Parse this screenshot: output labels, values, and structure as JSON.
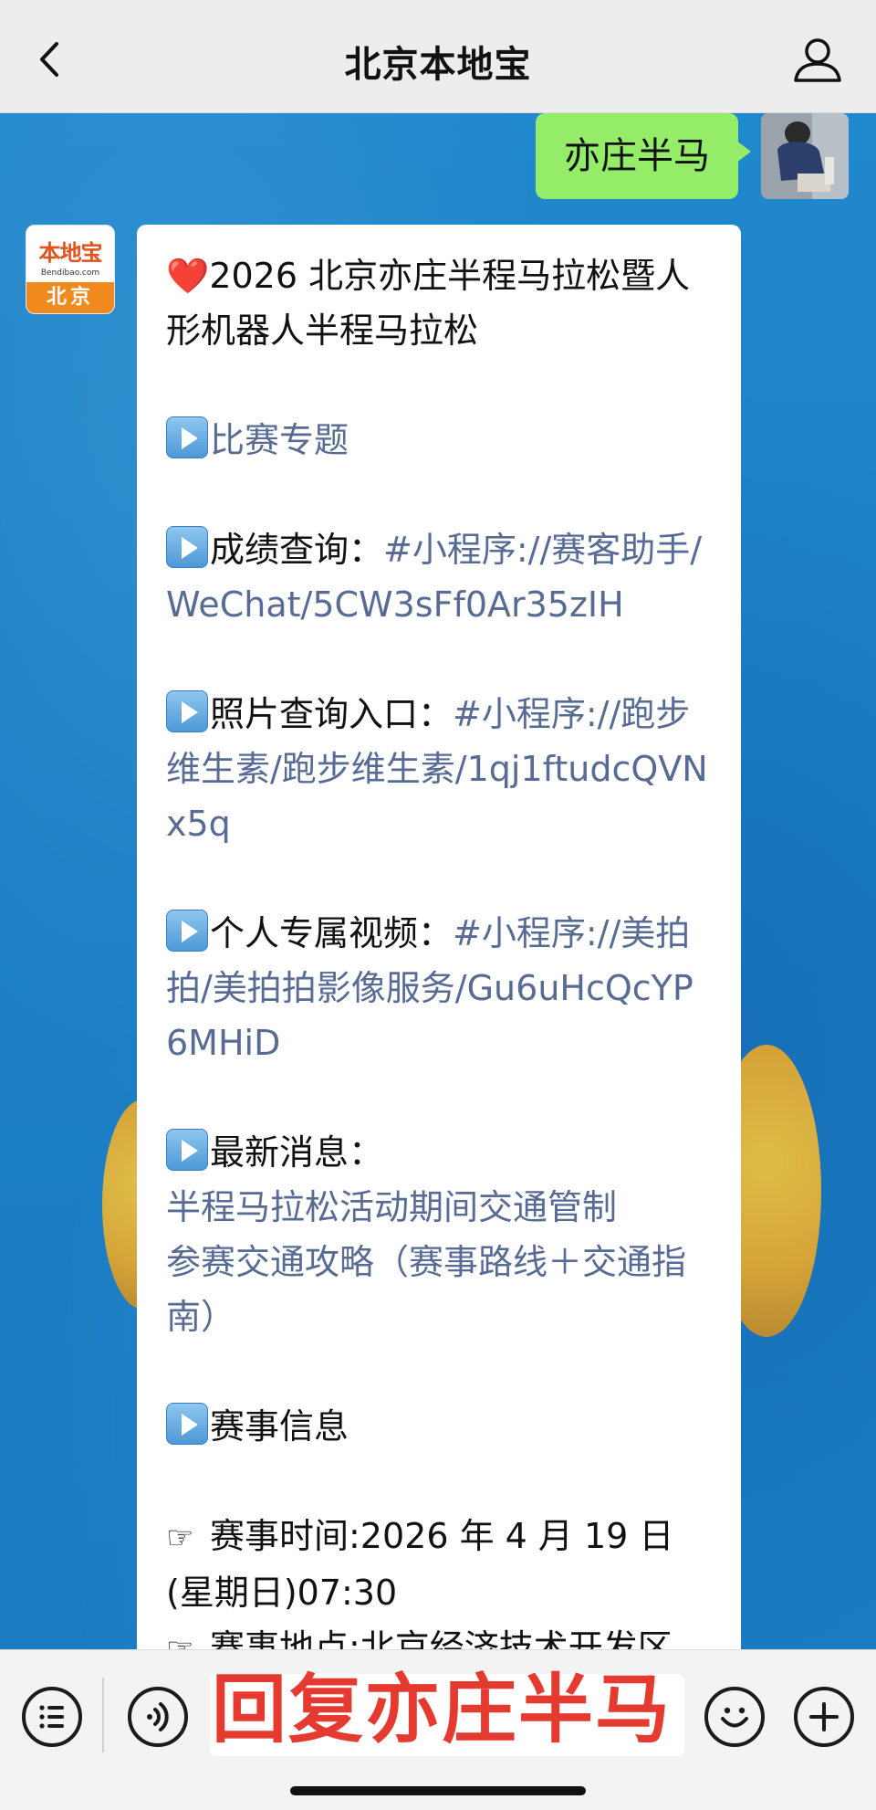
{
  "header": {
    "title": "北京本地宝",
    "back_icon": "chevron-left-icon",
    "profile_icon": "person-icon"
  },
  "outgoing": {
    "text": "亦庄半马"
  },
  "bot": {
    "avatar_brand": "本地宝",
    "avatar_domain": "Bendibao.com",
    "avatar_city": "北京"
  },
  "message": {
    "title": "2026 北京亦庄半程马拉松暨人形机器人半程马拉松",
    "item_topic": "比赛专题",
    "item_results_label": "成绩查询：",
    "item_results_link": "#小程序://赛客助手/WeChat/5CW3sFf0Ar35zIH",
    "item_photos_label": "照片查询入口：",
    "item_photos_link": "#小程序://跑步维生素/跑步维生素/1qj1ftudcQVNx5q",
    "item_video_label": "个人专属视频：",
    "item_video_link": "#小程序://美拍拍/美拍拍影像服务/Gu6uHcQcYP6MHiD",
    "item_news_label": "最新消息：",
    "news_link_1": "半程马拉松活动期间交通管制",
    "news_link_2": "参赛交通攻略（赛事路线＋交通指南）",
    "item_info_label": "赛事信息",
    "info_time": "赛事时间:2026 年 4 月 19 日(星期日)07:30",
    "info_place": "赛事地点:北京经济技术开发区"
  },
  "input_bar": {
    "overlay_text": "回复亦庄半马",
    "menu_icon": "list-menu-icon",
    "voice_icon": "voice-icon",
    "emoji_icon": "emoji-icon",
    "plus_icon": "plus-icon"
  },
  "colors": {
    "header_bg": "#ededed",
    "chat_bg": "#1f83c9",
    "out_bubble": "#95ec69",
    "link": "#576b95",
    "overlay_red": "#e53a30"
  }
}
